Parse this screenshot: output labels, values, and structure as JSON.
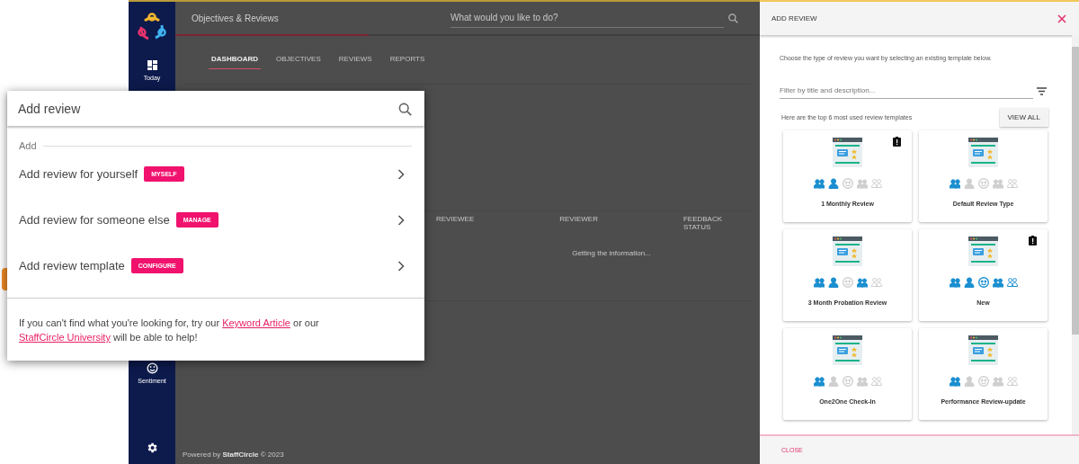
{
  "sidebar": {
    "items": [
      {
        "kind": "today",
        "label": "Today"
      },
      {
        "kind": "sentiment",
        "label": "Sentiment"
      }
    ]
  },
  "header": {
    "title": "Objectives & Reviews",
    "search": {
      "placeholder": "What would you like to do?"
    },
    "loading": {
      "level": 0.33
    }
  },
  "tabs": [
    {
      "label": "DASHBOARD",
      "selected": true
    },
    {
      "label": "OBJECTIVES",
      "selected": false
    },
    {
      "label": "REVIEWS",
      "selected": false
    },
    {
      "label": "REPORTS",
      "selected": false
    }
  ],
  "table": {
    "columns": [
      "REVIEWEE",
      "REVIEWER",
      "FEEDBACK STATUS"
    ],
    "message": "Getting the information..."
  },
  "footer": "Powered by **StaffCircle** © 2023",
  "quick_add": {
    "search": {
      "value": "Add review"
    },
    "section": "Add",
    "items": [
      {
        "label": "Add review for yourself",
        "badge": "MYSELF"
      },
      {
        "label": "Add review for someone else",
        "badge": "MANAGE"
      },
      {
        "label": "Add review template",
        "badge": "CONFIGURE"
      }
    ],
    "help": [
      {
        "kind": "text",
        "text": "If you can't find what you're looking for, try our "
      },
      {
        "kind": "link",
        "text": "Keyword Article"
      },
      {
        "kind": "text",
        "text": " or our "
      },
      {
        "kind": "link",
        "text": "StaffCircle University"
      },
      {
        "kind": "text",
        "text": " will be able to help!"
      }
    ]
  },
  "drawer": {
    "title": "ADD REVIEW",
    "intro": "Choose the type of review you want by selecting an existing template below.",
    "filter": {
      "placeholder": "Filter by title and description..."
    },
    "top_label": "Here are the top 6 most used review templates",
    "view_all": "VIEW ALL",
    "templates": [
      {
        "name": "1 Monthly Review",
        "flagged": true,
        "roles": [
          {
            "kind": "pair",
            "active": true
          },
          {
            "kind": "person",
            "active": true
          },
          {
            "kind": "face",
            "active": false
          },
          {
            "kind": "group",
            "active": false
          },
          {
            "kind": "team",
            "active": false
          }
        ]
      },
      {
        "name": "Default Review Type",
        "flagged": false,
        "roles": [
          {
            "kind": "pair",
            "active": true
          },
          {
            "kind": "person",
            "active": false
          },
          {
            "kind": "face",
            "active": false
          },
          {
            "kind": "group",
            "active": false
          },
          {
            "kind": "team",
            "active": false
          }
        ]
      },
      {
        "name": "3 Month Probation Review",
        "flagged": false,
        "roles": [
          {
            "kind": "pair",
            "active": true
          },
          {
            "kind": "person",
            "active": true
          },
          {
            "kind": "face",
            "active": false
          },
          {
            "kind": "group",
            "active": true
          },
          {
            "kind": "team",
            "active": false
          }
        ]
      },
      {
        "name": "New",
        "flagged": true,
        "roles": [
          {
            "kind": "pair",
            "active": true
          },
          {
            "kind": "person",
            "active": true
          },
          {
            "kind": "face",
            "active": true
          },
          {
            "kind": "group",
            "active": true
          },
          {
            "kind": "team",
            "active": true
          }
        ]
      },
      {
        "name": "One2One Check-In",
        "flagged": false,
        "roles": [
          {
            "kind": "pair",
            "active": true
          },
          {
            "kind": "person",
            "active": false
          },
          {
            "kind": "face",
            "active": false
          },
          {
            "kind": "group",
            "active": false
          },
          {
            "kind": "team",
            "active": false
          }
        ]
      },
      {
        "name": "Performance Review-update",
        "flagged": false,
        "roles": [
          {
            "kind": "pair",
            "active": true
          },
          {
            "kind": "person",
            "active": false
          },
          {
            "kind": "face",
            "active": false
          },
          {
            "kind": "group",
            "active": false
          },
          {
            "kind": "team",
            "active": false
          }
        ]
      }
    ],
    "close": "CLOSE"
  }
}
